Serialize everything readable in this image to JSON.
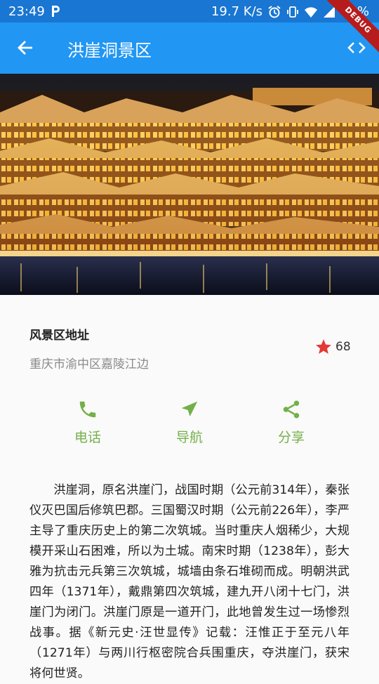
{
  "status_bar": {
    "time": "23:49",
    "network_speed": "19.7 K/s",
    "battery": "52%"
  },
  "app_bar": {
    "title": "洪崖洞景区"
  },
  "debug_banner": "DEBUG",
  "hero_image": {
    "subject": "Hongyadong illuminated at night"
  },
  "info": {
    "address_label": "风景区地址",
    "address": "重庆市渝中区嘉陵江边",
    "rating": "68"
  },
  "actions": [
    {
      "label": "电话",
      "icon": "phone-icon"
    },
    {
      "label": "导航",
      "icon": "navigation-icon"
    },
    {
      "label": "分享",
      "icon": "share-icon"
    }
  ],
  "description": "洪崖洞，原名洪崖门，战国时期（公元前314年），秦张仪灭巴国后修筑巴郡。三国蜀汉时期（公元前226年），李严主导了重庆历史上的第二次筑城。当时重庆人烟稀少，大规模开采山石困难，所以为土城。南宋时期（1238年），彭大雅为抗击元兵第三次筑城，城墙由条石堆砌而成。明朝洪武四年（1371年），戴鼎第四次筑城，建九开八闭十七门，洪崖门为闭门。洪崖门原是一道开门，此地曾发生过一场惨烈战事。据《新元史·汪世显传》记载：汪惟正于至元八年（1271年）与两川行枢密院合兵围重庆，夺洪崖门，获宋将何世贤。",
  "colors": {
    "status_bar": "#1976d2",
    "app_bar": "#2196f3",
    "accent_green": "#74b04a",
    "star_red": "#e53935"
  }
}
